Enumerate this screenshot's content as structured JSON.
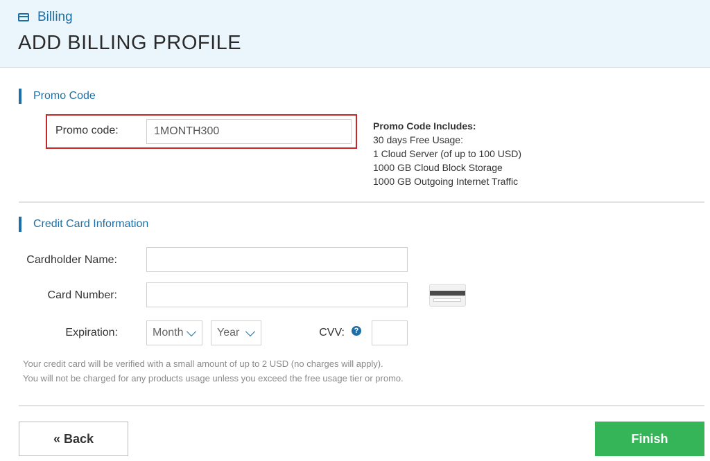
{
  "header": {
    "breadcrumb": "Billing",
    "breadcrumb_icon": "credit-card-icon",
    "title": "ADD BILLING PROFILE"
  },
  "promo": {
    "section_title": "Promo Code",
    "label": "Promo code:",
    "value": "1MONTH300",
    "includes_title": "Promo Code Includes:",
    "includes": [
      "30 days Free Usage:",
      "1 Cloud Server (of up to 100 USD)",
      "1000 GB Cloud Block Storage",
      "1000 GB Outgoing Internet Traffic"
    ]
  },
  "card": {
    "section_title": "Credit Card Information",
    "cardholder_label": "Cardholder Name:",
    "cardholder_value": "",
    "number_label": "Card Number:",
    "number_value": "",
    "expiration_label": "Expiration:",
    "month_select": "Month",
    "year_select": "Year",
    "cvv_label": "CVV:",
    "cvv_help": "?",
    "card_image_icon": "credit-card-back-icon",
    "note_lines": [
      "Your credit card will be verified with a small amount of up to 2 USD (no charges will apply).",
      "You will not be charged for any products usage unless you exceed the free usage tier or promo."
    ]
  },
  "footer": {
    "back_label": "« Back",
    "finish_label": "Finish"
  },
  "colors": {
    "accent": "#1d6fa5",
    "header_bg": "#eaf6fc",
    "highlight_border": "#c62828",
    "finish_bg": "#35b558"
  }
}
